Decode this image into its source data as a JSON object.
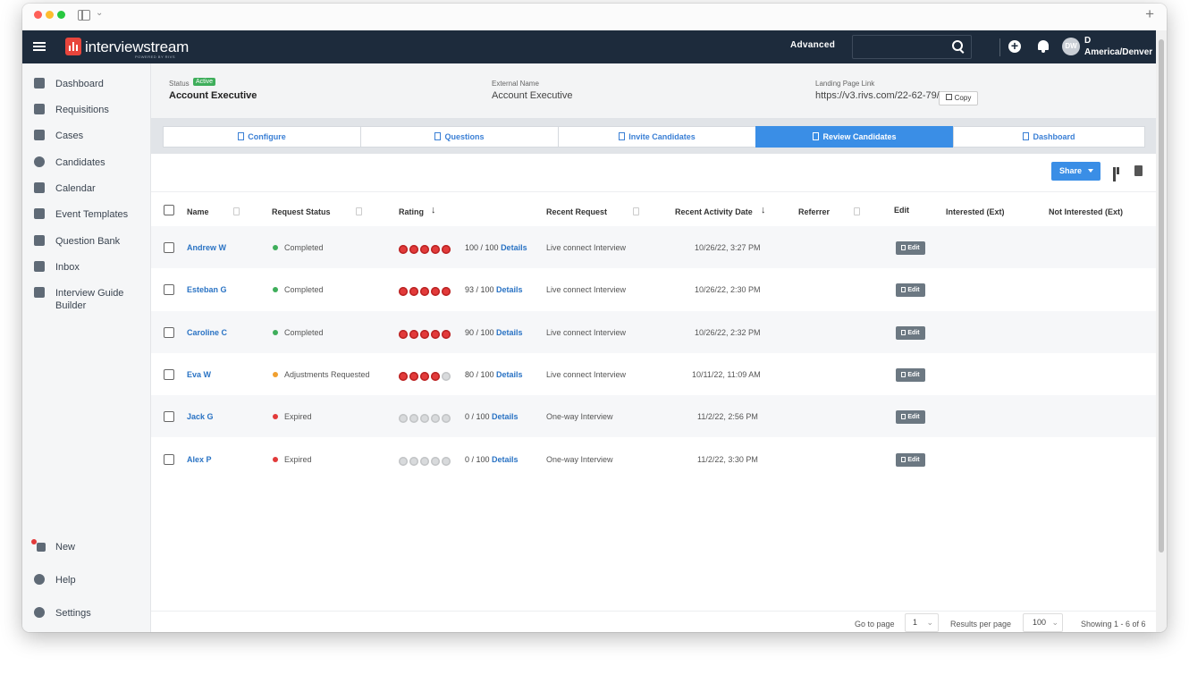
{
  "header": {
    "logo_text": "interviewstream",
    "logo_sub": "POWERED BY RIVS",
    "advanced_label": "Advanced",
    "search_placeholder": "",
    "avatar_initials": "DW",
    "user_initial": "D",
    "user_timezone": "America/Denver"
  },
  "sidebar": {
    "items": [
      {
        "label": "Dashboard",
        "icon": "chart-icon"
      },
      {
        "label": "Requisitions",
        "icon": "document-icon"
      },
      {
        "label": "Cases",
        "icon": "calendar-icon"
      },
      {
        "label": "Candidates",
        "icon": "people-icon"
      },
      {
        "label": "Calendar",
        "icon": "calendar-icon"
      },
      {
        "label": "Event Templates",
        "icon": "event-icon"
      },
      {
        "label": "Question Bank",
        "icon": "file-icon"
      },
      {
        "label": "Inbox",
        "icon": "inbox-icon"
      },
      {
        "label": "Interview Guide Builder",
        "icon": "guide-icon"
      }
    ],
    "bottom": [
      {
        "label": "New",
        "icon": "sparkle-icon"
      },
      {
        "label": "Help",
        "icon": "help-icon"
      },
      {
        "label": "Settings",
        "icon": "gear-icon"
      }
    ]
  },
  "info": {
    "status_label": "Status",
    "status_badge": "Active",
    "requisition_name": "Account Executive",
    "external_name_label": "External Name",
    "external_name": "Account Executive",
    "landing_label": "Landing Page Link",
    "landing_url": "https://v3.rivs.com/22-62-79/",
    "copy_label": "Copy"
  },
  "steps": [
    {
      "label": "Configure",
      "active": false
    },
    {
      "label": "Questions",
      "active": false
    },
    {
      "label": "Invite Candidates",
      "active": false
    },
    {
      "label": "Review Candidates",
      "active": true
    },
    {
      "label": "Dashboard",
      "active": false
    }
  ],
  "toolbar": {
    "share_label": "Share"
  },
  "table": {
    "headers": {
      "name": "Name",
      "request_status": "Request Status",
      "rating": "Rating",
      "recent_request": "Recent Request",
      "recent_activity": "Recent Activity Date",
      "referrer": "Referrer",
      "edit": "Edit",
      "interested": "Interested (Ext)",
      "not_interested": "Not Interested (Ext)"
    },
    "rows": [
      {
        "name": "Andrew W",
        "status": "Completed",
        "status_color": "#3fae5b",
        "rating": 5,
        "score": "100 / 100",
        "details": "Details",
        "request": "Live connect Interview",
        "date": "10/26/22, 3:27 PM",
        "edit": "Edit"
      },
      {
        "name": "Esteban G",
        "status": "Completed",
        "status_color": "#3fae5b",
        "rating": 5,
        "score": "93 / 100",
        "details": "Details",
        "request": "Live connect Interview",
        "date": "10/26/22, 2:30 PM",
        "edit": "Edit"
      },
      {
        "name": "Caroline C",
        "status": "Completed",
        "status_color": "#3fae5b",
        "rating": 5,
        "score": "90 / 100",
        "details": "Details",
        "request": "Live connect Interview",
        "date": "10/26/22, 2:32 PM",
        "edit": "Edit"
      },
      {
        "name": "Eva W",
        "status": "Adjustments Requested",
        "status_color": "#f0a030",
        "rating": 4,
        "score": "80 / 100",
        "details": "Details",
        "request": "Live connect Interview",
        "date": "10/11/22, 11:09 AM",
        "edit": "Edit"
      },
      {
        "name": "Jack G",
        "status": "Expired",
        "status_color": "#e23a3a",
        "rating": 0,
        "score": "0 / 100",
        "details": "Details",
        "request": "One-way Interview",
        "date": "11/2/22, 2:56 PM",
        "edit": "Edit"
      },
      {
        "name": "Alex P",
        "status": "Expired",
        "status_color": "#e23a3a",
        "rating": 0,
        "score": "0 / 100",
        "details": "Details",
        "request": "One-way Interview",
        "date": "11/2/22, 3:30 PM",
        "edit": "Edit"
      }
    ]
  },
  "footer": {
    "go_to_page_label": "Go to page",
    "page_value": "1",
    "results_label": "Results per page",
    "results_value": "100",
    "showing": "Showing 1 - 6 of 6"
  }
}
